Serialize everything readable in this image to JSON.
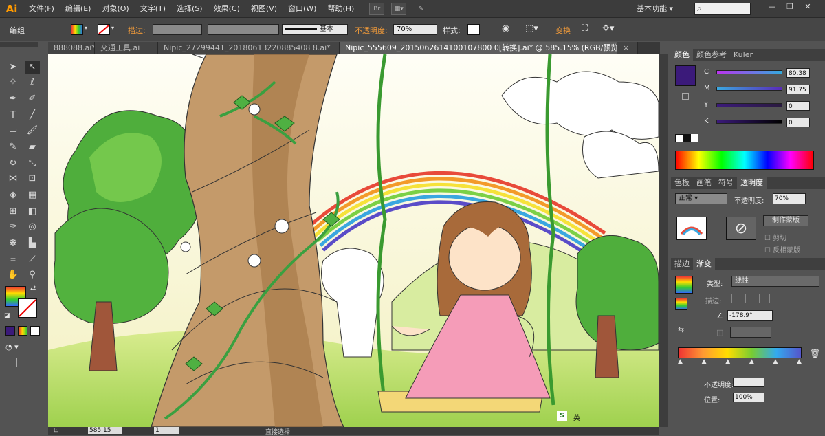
{
  "app": {
    "logo": "Ai"
  },
  "menu": [
    "文件(F)",
    "编辑(E)",
    "对象(O)",
    "文字(T)",
    "选择(S)",
    "效果(C)",
    "视图(V)",
    "窗口(W)",
    "帮助(H)"
  ],
  "menubar_icons": {
    "bridge": "Br"
  },
  "workspace": "基本功能",
  "window_buttons": [
    "—",
    "❐",
    "✕"
  ],
  "control": {
    "mode": "编组",
    "stroke_label": "描边:",
    "brush_label": "基本",
    "opacity_label": "不透明度:",
    "opacity_value": "70%",
    "style_label": "样式:",
    "transform_label": "变换"
  },
  "tabs": [
    "888088.ai*",
    "交通工具.ai",
    "Nipic_27299441_20180613220885408 8.ai*",
    "Nipic_555609_2015062614100107800 0[转换].ai* @ 585.15% (RGB/预览)"
  ],
  "tab_close": "×",
  "color_panel": {
    "tabs": [
      "颜色",
      "颜色参考",
      "Kuler"
    ],
    "channels": [
      {
        "label": "C",
        "value": "80.38"
      },
      {
        "label": "M",
        "value": "91.75"
      },
      {
        "label": "Y",
        "value": "0"
      },
      {
        "label": "K",
        "value": "0"
      }
    ],
    "fill_color": "#3b1a7a"
  },
  "transparency_panel": {
    "tabs": [
      "色板",
      "画笔",
      "符号",
      "透明度"
    ],
    "blend_mode": "正常",
    "opacity_label": "不透明度:",
    "opacity_value": "70%",
    "make_mask_button": "制作蒙版",
    "clip_label": "剪切",
    "invert_label": "反相蒙版"
  },
  "gradient_panel": {
    "tabs": [
      "描边",
      "渐变"
    ],
    "type_label": "类型:",
    "type_value": "线性",
    "stroke_label": "描边:",
    "angle_value": "-178.9°",
    "opacity_label": "不透明度:",
    "location_label": "位置:",
    "location_value": "100%"
  },
  "status": {
    "zoom": "585.15",
    "page": "1",
    "tool_name": "直接选择"
  },
  "taskbar_icons": {
    "ime": "S",
    "lang": "英"
  }
}
